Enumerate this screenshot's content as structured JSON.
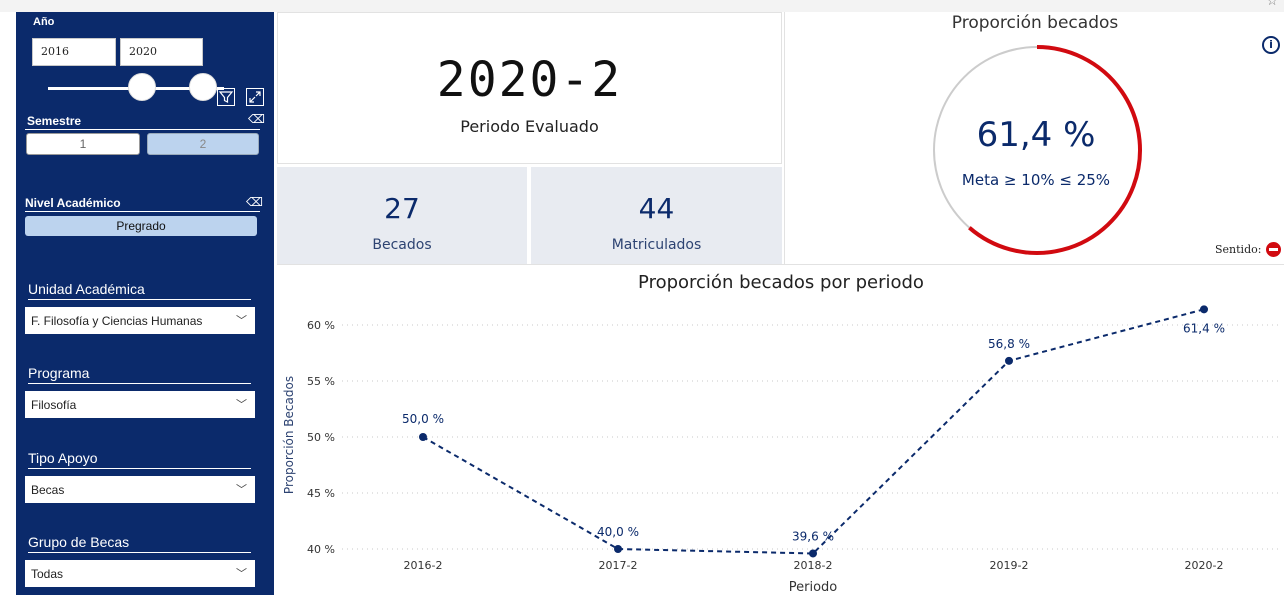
{
  "sidebar": {
    "year": {
      "label": "Año",
      "from": "2016",
      "to": "2020",
      "range_min": 2016,
      "range_max": 2020,
      "selected_from": 2016,
      "selected_to": 2020
    },
    "semester": {
      "label": "Semestre",
      "options": [
        "1",
        "2"
      ],
      "selected": "2"
    },
    "academic_level": {
      "label": "Nivel Académico",
      "selected": "Pregrado"
    },
    "academic_unit": {
      "label": "Unidad Académica",
      "value": "F. Filosofía y Ciencias Humanas"
    },
    "program": {
      "label": "Programa",
      "value": "Filosofía"
    },
    "support_type": {
      "label": "Tipo Apoyo",
      "value": "Becas"
    },
    "scholarship_group": {
      "label": "Grupo de Becas",
      "value": "Todas"
    }
  },
  "period_card": {
    "value": "2020-2",
    "label": "Periodo Evaluado"
  },
  "kpis": [
    {
      "value": "27",
      "label": "Becados"
    },
    {
      "value": "44",
      "label": "Matriculados"
    }
  ],
  "gauge": {
    "title": "Proporción becados",
    "value_text": "61,4 %",
    "value_fraction": 0.614,
    "goal_text": "Meta ≥ 10% ≤ 25%",
    "sentido_label": "Sentido:",
    "colors": {
      "fill": "#d10a10",
      "track": "#cccccc",
      "value": "#0b2a6b"
    }
  },
  "chart_data": {
    "type": "line",
    "title": "Proporción becados por periodo",
    "xlabel": "Periodo",
    "ylabel": "Proporción Becados",
    "categories": [
      "2016-2",
      "2017-2",
      "2018-2",
      "2019-2",
      "2020-2"
    ],
    "values": [
      50.0,
      40.0,
      39.6,
      56.8,
      61.4
    ],
    "data_labels": [
      "50,0 %",
      "40,0 %",
      "39,6 %",
      "56,8 %",
      "61,4 %"
    ],
    "yticks": [
      40,
      45,
      50,
      55,
      60
    ],
    "ytick_labels": [
      "40 %",
      "45 %",
      "50 %",
      "55 %",
      "60 %"
    ],
    "ylim": [
      39.6,
      61.4
    ],
    "line_style": "dashed",
    "grid": true,
    "color": "#0b2a6b"
  }
}
